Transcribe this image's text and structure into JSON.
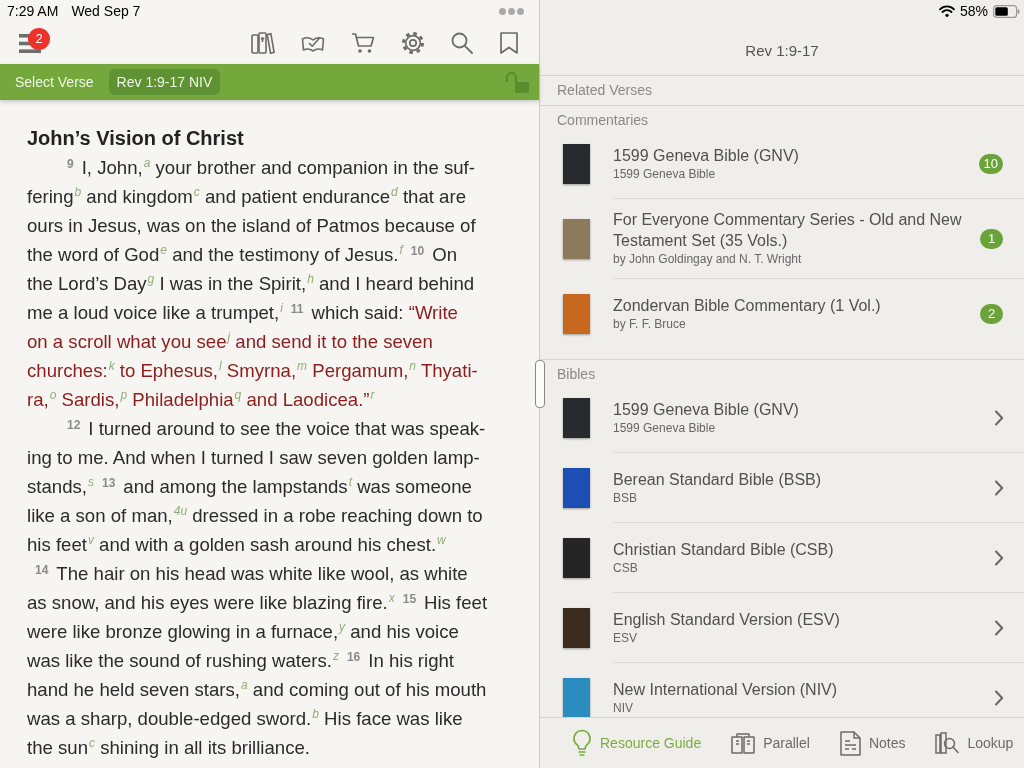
{
  "status_bar": {
    "time": "7:29 AM",
    "date": "Wed Sep 7",
    "battery": "58%"
  },
  "toolbar": {
    "menu_badge": "2"
  },
  "verse_bar": {
    "label": "Select Verse",
    "reference": "Rev 1:9-17 NIV",
    "locked": false
  },
  "passage": {
    "heading": "John’s Vision of Christ",
    "paragraphs": [
      {
        "indented": true,
        "lines": [
          [
            {
              "kind": "verse",
              "text": "9"
            },
            {
              "kind": "text",
              "text": "I, John,",
              "red_letter": false
            },
            {
              "kind": "note",
              "text": "a"
            },
            {
              "kind": "text",
              "text": " your brother and companion in the suf-",
              "red_letter": false
            }
          ],
          [
            {
              "kind": "text",
              "text": "fering",
              "red_letter": false
            },
            {
              "kind": "note",
              "text": "b"
            },
            {
              "kind": "text",
              "text": " and kingdom",
              "red_letter": false
            },
            {
              "kind": "note",
              "text": "c"
            },
            {
              "kind": "text",
              "text": " and patient endurance",
              "red_letter": false
            },
            {
              "kind": "note",
              "text": "d"
            },
            {
              "kind": "text",
              "text": " that are",
              "red_letter": false
            }
          ],
          [
            {
              "kind": "text",
              "text": "ours in Jesus, was on the island of Patmos because of",
              "red_letter": false
            }
          ],
          [
            {
              "kind": "text",
              "text": "the word of God",
              "red_letter": false
            },
            {
              "kind": "note",
              "text": "e"
            },
            {
              "kind": "text",
              "text": " and the testimony of Jesus.",
              "red_letter": false
            },
            {
              "kind": "note",
              "text": "f"
            },
            {
              "kind": "verse",
              "text": "10"
            },
            {
              "kind": "text",
              "text": "On",
              "red_letter": false
            }
          ],
          [
            {
              "kind": "text",
              "text": "the Lord’s Day",
              "red_letter": false
            },
            {
              "kind": "note",
              "text": "g"
            },
            {
              "kind": "text",
              "text": " I was in the Spirit,",
              "red_letter": false
            },
            {
              "kind": "note",
              "text": "h"
            },
            {
              "kind": "text",
              "text": " and I heard behind",
              "red_letter": false
            }
          ],
          [
            {
              "kind": "text",
              "text": "me a loud voice like a trumpet,",
              "red_letter": false
            },
            {
              "kind": "note",
              "text": "i"
            },
            {
              "kind": "verse",
              "text": "11"
            },
            {
              "kind": "text",
              "text": "which said: ",
              "red_letter": false
            },
            {
              "kind": "text",
              "text": "“Write",
              "red_letter": true
            }
          ],
          [
            {
              "kind": "text",
              "text": "on a scroll what you see",
              "red_letter": true
            },
            {
              "kind": "note",
              "text": "j"
            },
            {
              "kind": "text",
              "text": " and send it to the seven",
              "red_letter": true
            }
          ],
          [
            {
              "kind": "text",
              "text": "churches:",
              "red_letter": true
            },
            {
              "kind": "note",
              "text": "k"
            },
            {
              "kind": "text",
              "text": " to Ephesus,",
              "red_letter": true
            },
            {
              "kind": "note",
              "text": "l"
            },
            {
              "kind": "text",
              "text": " Smyrna,",
              "red_letter": true
            },
            {
              "kind": "note",
              "text": "m"
            },
            {
              "kind": "text",
              "text": " Pergamum,",
              "red_letter": true
            },
            {
              "kind": "note",
              "text": "n"
            },
            {
              "kind": "text",
              "text": " Thyati-",
              "red_letter": true
            }
          ],
          [
            {
              "kind": "text",
              "text": "ra,",
              "red_letter": true
            },
            {
              "kind": "note",
              "text": "o"
            },
            {
              "kind": "text",
              "text": " Sardis,",
              "red_letter": true
            },
            {
              "kind": "note",
              "text": "p"
            },
            {
              "kind": "text",
              "text": " Philadelphia",
              "red_letter": true
            },
            {
              "kind": "note",
              "text": "q"
            },
            {
              "kind": "text",
              "text": " and Laodicea.”",
              "red_letter": true
            },
            {
              "kind": "note",
              "text": "r"
            }
          ]
        ]
      },
      {
        "indented": true,
        "lines": [
          [
            {
              "kind": "verse",
              "text": "12"
            },
            {
              "kind": "text",
              "text": "I turned around to see the voice that was speak-",
              "red_letter": false
            }
          ],
          [
            {
              "kind": "text",
              "text": "ing to me. And when I turned I saw seven golden lamp-",
              "red_letter": false
            }
          ],
          [
            {
              "kind": "text",
              "text": "stands,",
              "red_letter": false
            },
            {
              "kind": "note",
              "text": "s"
            },
            {
              "kind": "verse",
              "text": "13"
            },
            {
              "kind": "text",
              "text": "and among the lampstands",
              "red_letter": false
            },
            {
              "kind": "note",
              "text": "t"
            },
            {
              "kind": "text",
              "text": " was someone",
              "red_letter": false
            }
          ],
          [
            {
              "kind": "text",
              "text": "like a son of man,",
              "red_letter": false
            },
            {
              "kind": "note",
              "text": "4u"
            },
            {
              "kind": "text",
              "text": " dressed in a robe reaching down to",
              "red_letter": false
            }
          ],
          [
            {
              "kind": "text",
              "text": "his feet",
              "red_letter": false
            },
            {
              "kind": "note",
              "text": "v"
            },
            {
              "kind": "text",
              "text": " and with a golden sash around his chest.",
              "red_letter": false
            },
            {
              "kind": "note",
              "text": "w"
            }
          ]
        ]
      },
      {
        "indented": false,
        "lines": [
          [
            {
              "kind": "verse",
              "text": "14"
            },
            {
              "kind": "text",
              "text": "The hair on his head was white like wool, as white",
              "red_letter": false
            }
          ],
          [
            {
              "kind": "text",
              "text": "as snow, and his eyes were like blazing fire.",
              "red_letter": false
            },
            {
              "kind": "note",
              "text": "x"
            },
            {
              "kind": "verse",
              "text": "15"
            },
            {
              "kind": "text",
              "text": "His feet",
              "red_letter": false
            }
          ],
          [
            {
              "kind": "text",
              "text": "were like bronze glowing in a furnace,",
              "red_letter": false
            },
            {
              "kind": "note",
              "text": "y"
            },
            {
              "kind": "text",
              "text": " and his voice",
              "red_letter": false
            }
          ],
          [
            {
              "kind": "text",
              "text": "was like the sound of rushing waters.",
              "red_letter": false
            },
            {
              "kind": "note",
              "text": "z"
            },
            {
              "kind": "verse",
              "text": "16"
            },
            {
              "kind": "text",
              "text": "In his right",
              "red_letter": false
            }
          ],
          [
            {
              "kind": "text",
              "text": "hand he held seven stars,",
              "red_letter": false
            },
            {
              "kind": "note",
              "text": "a"
            },
            {
              "kind": "text",
              "text": " and coming out of his mouth",
              "red_letter": false
            }
          ],
          [
            {
              "kind": "text",
              "text": "was a sharp, double-edged sword.",
              "red_letter": false
            },
            {
              "kind": "note",
              "text": "b"
            },
            {
              "kind": "text",
              "text": " His face was like",
              "red_letter": false
            }
          ],
          [
            {
              "kind": "text",
              "text": "the sun",
              "red_letter": false
            },
            {
              "kind": "note",
              "text": "c"
            },
            {
              "kind": "text",
              "text": " shining in all its brilliance.",
              "red_letter": false
            }
          ]
        ]
      }
    ]
  },
  "panel": {
    "title": "Rev 1:9-17",
    "sections": [
      {
        "title": "Related Verses"
      },
      {
        "title": "Commentaries",
        "items": [
          {
            "kind": "count",
            "title": "1599 Geneva Bible (GNV)",
            "subtitle": "1599 Geneva Bible",
            "badge": "10",
            "color": "#272b2d"
          },
          {
            "kind": "count",
            "title": "For Everyone Commentary Series - Old and New Testament Set (35 Vols.)",
            "subtitle": "by John Goldingay and N. T. Wright",
            "badge": "1",
            "color": "#8c7a5c"
          },
          {
            "kind": "count",
            "title": "Zondervan Bible Commentary (1 Vol.)",
            "subtitle": "by F. F. Bruce",
            "badge": "2",
            "color": "#c8681f"
          }
        ]
      },
      {
        "title": "Bibles",
        "items": [
          {
            "kind": "link",
            "title": "1599 Geneva Bible (GNV)",
            "subtitle": "1599 Geneva Bible",
            "color": "#272b2d"
          },
          {
            "kind": "link",
            "title": "Berean Standard Bible (BSB)",
            "subtitle": "BSB",
            "color": "#1c4fb4"
          },
          {
            "kind": "link",
            "title": "Christian Standard Bible (CSB)",
            "subtitle": "CSB",
            "color": "#252525"
          },
          {
            "kind": "link",
            "title": "English Standard Version (ESV)",
            "subtitle": "ESV",
            "color": "#3b2c1e"
          },
          {
            "kind": "link",
            "title": "New International Version (NIV)",
            "subtitle": "NIV",
            "color": "#2b8cc0"
          }
        ]
      }
    ]
  },
  "bottom_tabs": [
    {
      "label": "Resource Guide",
      "selected": true
    },
    {
      "label": "Parallel",
      "selected": false
    },
    {
      "label": "Notes",
      "selected": false
    },
    {
      "label": "Lookup",
      "selected": false
    }
  ]
}
